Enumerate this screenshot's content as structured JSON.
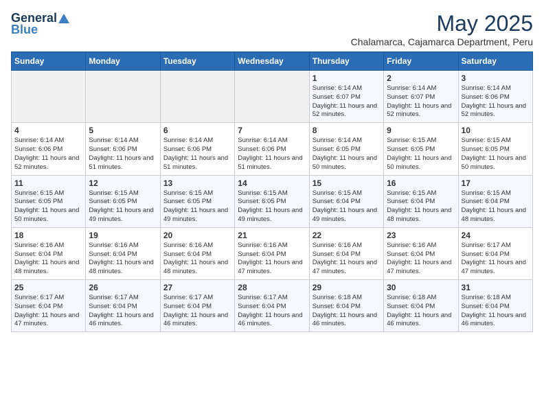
{
  "header": {
    "logo_line1": "General",
    "logo_line2": "Blue",
    "month_year": "May 2025",
    "location": "Chalamarca, Cajamarca Department, Peru"
  },
  "weekdays": [
    "Sunday",
    "Monday",
    "Tuesday",
    "Wednesday",
    "Thursday",
    "Friday",
    "Saturday"
  ],
  "weeks": [
    [
      {
        "day": "",
        "info": ""
      },
      {
        "day": "",
        "info": ""
      },
      {
        "day": "",
        "info": ""
      },
      {
        "day": "",
        "info": ""
      },
      {
        "day": "1",
        "info": "Sunrise: 6:14 AM\nSunset: 6:07 PM\nDaylight: 11 hours\nand 52 minutes."
      },
      {
        "day": "2",
        "info": "Sunrise: 6:14 AM\nSunset: 6:07 PM\nDaylight: 11 hours\nand 52 minutes."
      },
      {
        "day": "3",
        "info": "Sunrise: 6:14 AM\nSunset: 6:06 PM\nDaylight: 11 hours\nand 52 minutes."
      }
    ],
    [
      {
        "day": "4",
        "info": "Sunrise: 6:14 AM\nSunset: 6:06 PM\nDaylight: 11 hours\nand 52 minutes."
      },
      {
        "day": "5",
        "info": "Sunrise: 6:14 AM\nSunset: 6:06 PM\nDaylight: 11 hours\nand 51 minutes."
      },
      {
        "day": "6",
        "info": "Sunrise: 6:14 AM\nSunset: 6:06 PM\nDaylight: 11 hours\nand 51 minutes."
      },
      {
        "day": "7",
        "info": "Sunrise: 6:14 AM\nSunset: 6:06 PM\nDaylight: 11 hours\nand 51 minutes."
      },
      {
        "day": "8",
        "info": "Sunrise: 6:14 AM\nSunset: 6:05 PM\nDaylight: 11 hours\nand 50 minutes."
      },
      {
        "day": "9",
        "info": "Sunrise: 6:15 AM\nSunset: 6:05 PM\nDaylight: 11 hours\nand 50 minutes."
      },
      {
        "day": "10",
        "info": "Sunrise: 6:15 AM\nSunset: 6:05 PM\nDaylight: 11 hours\nand 50 minutes."
      }
    ],
    [
      {
        "day": "11",
        "info": "Sunrise: 6:15 AM\nSunset: 6:05 PM\nDaylight: 11 hours\nand 50 minutes."
      },
      {
        "day": "12",
        "info": "Sunrise: 6:15 AM\nSunset: 6:05 PM\nDaylight: 11 hours\nand 49 minutes."
      },
      {
        "day": "13",
        "info": "Sunrise: 6:15 AM\nSunset: 6:05 PM\nDaylight: 11 hours\nand 49 minutes."
      },
      {
        "day": "14",
        "info": "Sunrise: 6:15 AM\nSunset: 6:05 PM\nDaylight: 11 hours\nand 49 minutes."
      },
      {
        "day": "15",
        "info": "Sunrise: 6:15 AM\nSunset: 6:04 PM\nDaylight: 11 hours\nand 49 minutes."
      },
      {
        "day": "16",
        "info": "Sunrise: 6:15 AM\nSunset: 6:04 PM\nDaylight: 11 hours\nand 48 minutes."
      },
      {
        "day": "17",
        "info": "Sunrise: 6:15 AM\nSunset: 6:04 PM\nDaylight: 11 hours\nand 48 minutes."
      }
    ],
    [
      {
        "day": "18",
        "info": "Sunrise: 6:16 AM\nSunset: 6:04 PM\nDaylight: 11 hours\nand 48 minutes."
      },
      {
        "day": "19",
        "info": "Sunrise: 6:16 AM\nSunset: 6:04 PM\nDaylight: 11 hours\nand 48 minutes."
      },
      {
        "day": "20",
        "info": "Sunrise: 6:16 AM\nSunset: 6:04 PM\nDaylight: 11 hours\nand 48 minutes."
      },
      {
        "day": "21",
        "info": "Sunrise: 6:16 AM\nSunset: 6:04 PM\nDaylight: 11 hours\nand 47 minutes."
      },
      {
        "day": "22",
        "info": "Sunrise: 6:16 AM\nSunset: 6:04 PM\nDaylight: 11 hours\nand 47 minutes."
      },
      {
        "day": "23",
        "info": "Sunrise: 6:16 AM\nSunset: 6:04 PM\nDaylight: 11 hours\nand 47 minutes."
      },
      {
        "day": "24",
        "info": "Sunrise: 6:17 AM\nSunset: 6:04 PM\nDaylight: 11 hours\nand 47 minutes."
      }
    ],
    [
      {
        "day": "25",
        "info": "Sunrise: 6:17 AM\nSunset: 6:04 PM\nDaylight: 11 hours\nand 47 minutes."
      },
      {
        "day": "26",
        "info": "Sunrise: 6:17 AM\nSunset: 6:04 PM\nDaylight: 11 hours\nand 46 minutes."
      },
      {
        "day": "27",
        "info": "Sunrise: 6:17 AM\nSunset: 6:04 PM\nDaylight: 11 hours\nand 46 minutes."
      },
      {
        "day": "28",
        "info": "Sunrise: 6:17 AM\nSunset: 6:04 PM\nDaylight: 11 hours\nand 46 minutes."
      },
      {
        "day": "29",
        "info": "Sunrise: 6:18 AM\nSunset: 6:04 PM\nDaylight: 11 hours\nand 46 minutes."
      },
      {
        "day": "30",
        "info": "Sunrise: 6:18 AM\nSunset: 6:04 PM\nDaylight: 11 hours\nand 46 minutes."
      },
      {
        "day": "31",
        "info": "Sunrise: 6:18 AM\nSunset: 6:04 PM\nDaylight: 11 hours\nand 46 minutes."
      }
    ]
  ]
}
